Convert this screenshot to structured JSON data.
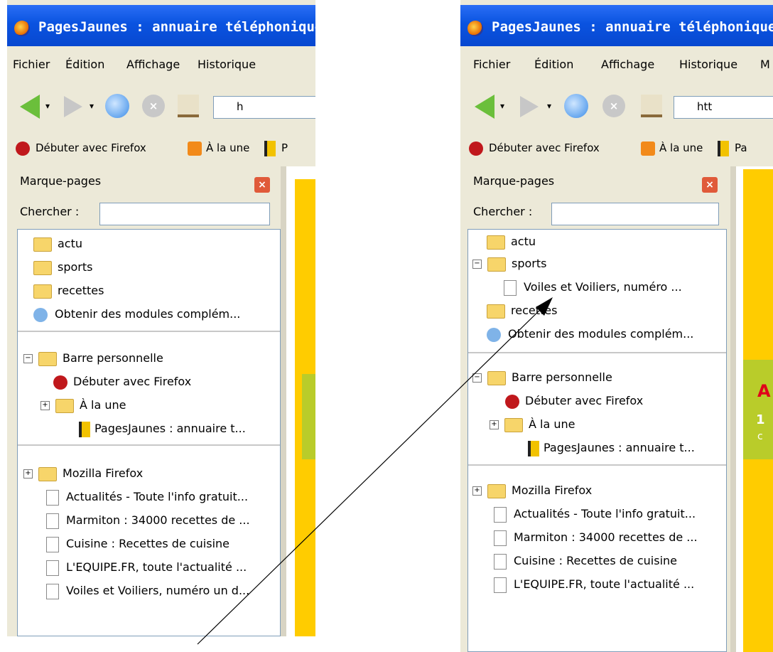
{
  "title": "PagesJaunes : annuaire téléphonique",
  "menu": [
    "Fichier",
    "Édition",
    "Affichage",
    "Historique",
    "M"
  ],
  "url_prefix_left": "h",
  "url_prefix_right": "htt",
  "bookmarks_toolbar": {
    "item1": "Débuter avec Firefox",
    "item2": "À la une",
    "item3_left": "P",
    "item3_right": "Pa"
  },
  "sidebar": {
    "title": "Marque-pages",
    "search_label": "Chercher :",
    "search_value": ""
  },
  "left_tree": {
    "folders": [
      "actu",
      "sports",
      "recettes"
    ],
    "addons": "Obtenir des modules complém...",
    "bar": "Barre personnelle",
    "bar_items": [
      "Débuter avec Firefox",
      "À la une",
      "PagesJaunes : annuaire t..."
    ],
    "mozilla": "Mozilla Firefox",
    "pages": [
      "Actualités - Toute l'info gratuit...",
      "Marmiton : 34000 recettes de ...",
      "Cuisine : Recettes de cuisine",
      "L'EQUIPE.FR, toute l'actualité ...",
      "Voiles et Voiliers, numéro un d..."
    ]
  },
  "right_tree": {
    "actu": "actu",
    "sports": "sports",
    "sports_child": "Voiles et Voiliers, numéro ...",
    "recettes": "recettes",
    "addons": "Obtenir des modules complém...",
    "bar": "Barre personnelle",
    "bar_items": [
      "Débuter avec Firefox",
      "À la une",
      "PagesJaunes : annuaire t..."
    ],
    "mozilla": "Mozilla Firefox",
    "pages": [
      "Actualités - Toute l'info gratuit...",
      "Marmiton : 34000 recettes de ...",
      "Cuisine : Recettes de cuisine",
      "L'EQUIPE.FR, toute l'actualité ..."
    ]
  },
  "content_right": {
    "l1": "A",
    "l2": "1",
    "l3": "c"
  },
  "colors": {
    "titlebar": "#0a53e0",
    "chrome": "#ece9d8",
    "page_yellow": "#ffcc00",
    "page_green": "#b9cc2a"
  }
}
